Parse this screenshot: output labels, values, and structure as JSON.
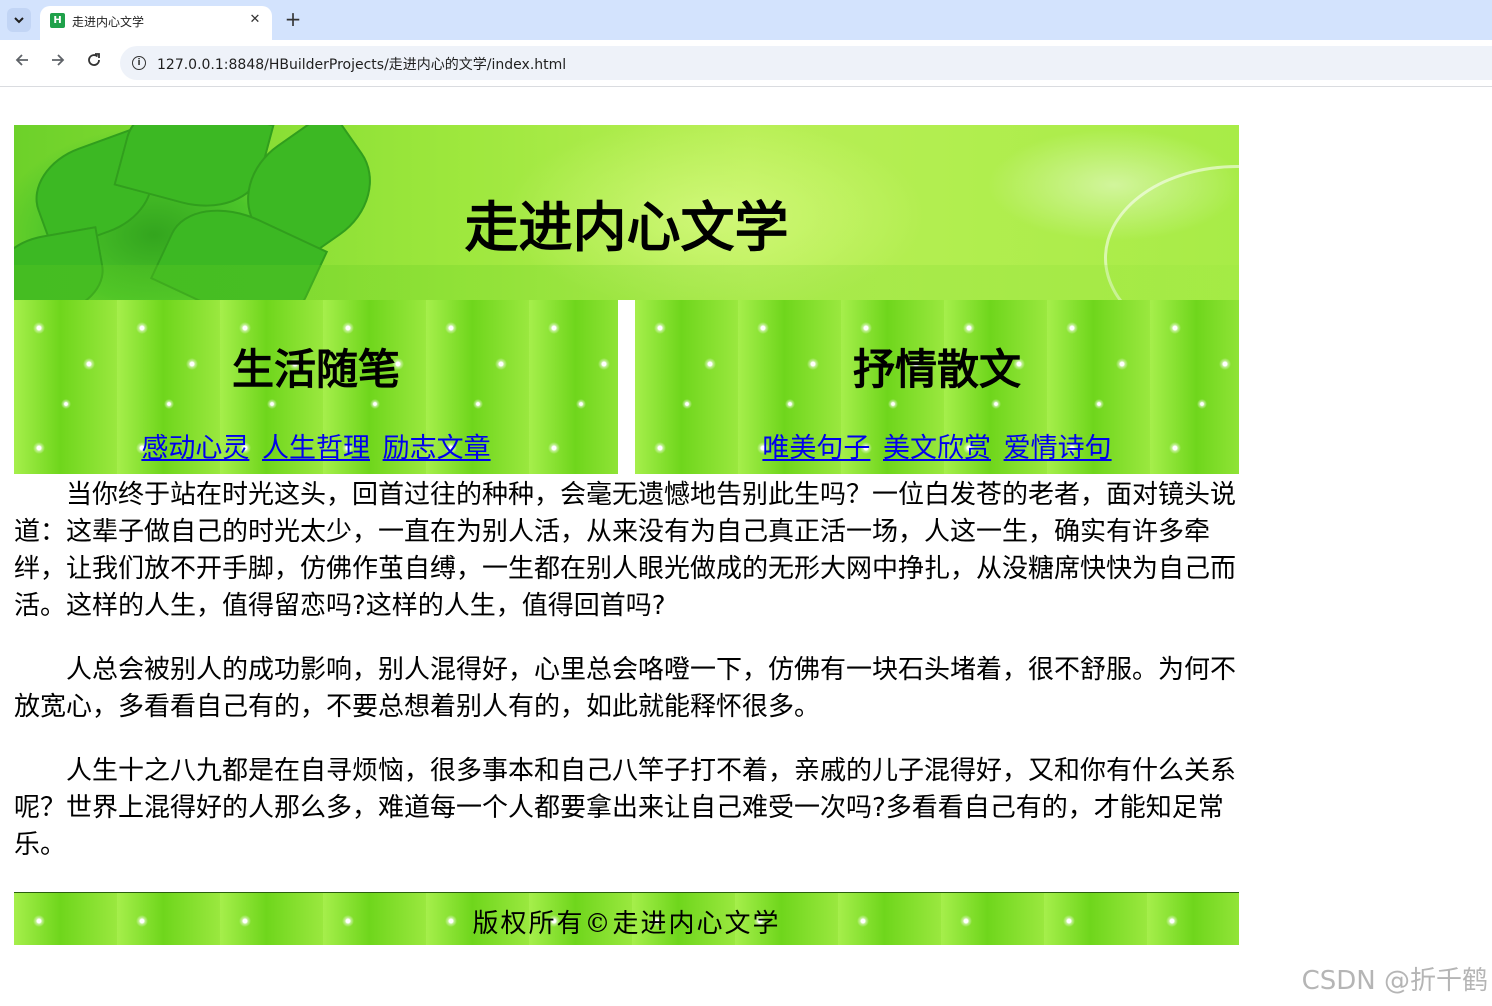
{
  "browser": {
    "tab_title": "走进内心文学",
    "favicon_letter": "H",
    "tab_close": "✕",
    "new_tab": "+",
    "url": "127.0.0.1:8848/HBuilderProjects/走进内心的文学/index.html",
    "icons": {
      "tab_menu": "chevron-down-icon",
      "back": "back-arrow-icon",
      "forward": "forward-arrow-icon",
      "reload": "reload-icon",
      "site_info": "info-icon"
    }
  },
  "page": {
    "site_title": "走进内心文学",
    "sections": [
      {
        "heading": "生活随笔",
        "links": [
          "感动心灵",
          "人生哲理",
          "励志文章"
        ]
      },
      {
        "heading": "抒情散文",
        "links": [
          "唯美句子",
          "美文欣赏",
          "爱情诗句"
        ]
      }
    ],
    "paragraphs": [
      "当你终于站在时光这头，回首过往的种种，会毫无遗憾地告别此生吗？一位白发苍的老者，面对镜头说道：这辈子做自己的时光太少，一直在为别人活，从来没有为自己真正活一场，人这一生，确实有许多牵绊，让我们放不开手脚，仿佛作茧自缚，一生都在别人眼光做成的无形大网中挣扎，从没糖席快快为自己而活。这样的人生，值得留恋吗?这样的人生，值得回首吗?",
      "人总会被别人的成功影响，别人混得好，心里总会咯噔一下，仿佛有一块石头堵着，很不舒服。为何不放宽心，多看看自己有的，不要总想着别人有的，如此就能释怀很多。",
      "人生十之八九都是在自寻烦恼，很多事本和自己八竿子打不着，亲戚的儿子混得好，又和你有什么关系呢？世界上混得好的人那么多，难道每一个人都要拿出来让自己难受一次吗?多看看自己有的，才能知足常乐。"
    ],
    "footer": "版权所有©走进内心文学"
  },
  "watermark": "CSDN @折千鹤",
  "colors": {
    "tabstrip": "#d3e3fd",
    "green_bg": "#7ee22c",
    "link": "#0000ee"
  }
}
